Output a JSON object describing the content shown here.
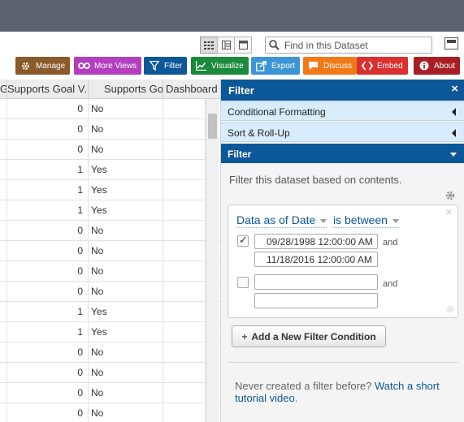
{
  "toolbar": {
    "view_buttons": [
      {
        "icon": "grid-view-icon",
        "active": true
      },
      {
        "icon": "card-view-icon",
        "active": false
      },
      {
        "icon": "single-row-view-icon",
        "active": false
      }
    ],
    "search_placeholder": "Find in this Dataset",
    "buttons": [
      {
        "label": "Manage",
        "icon": "gear-icon",
        "color": "#8a5a2a"
      },
      {
        "label": "More Views",
        "icon": "glasses-icon",
        "color": "#b33fbe"
      },
      {
        "label": "Filter",
        "icon": "funnel-icon",
        "color": "#0c5797"
      },
      {
        "label": "Visualize",
        "icon": "chart-icon",
        "color": "#1c8a3c"
      },
      {
        "label": "Export",
        "icon": "export-icon",
        "color": "#3e95d6"
      },
      {
        "label": "Discuss",
        "icon": "speech-bubble-icon",
        "color": "#f07a18"
      },
      {
        "label": "Embed",
        "icon": "code-brackets-icon",
        "color": "#d8312f"
      },
      {
        "label": "About",
        "icon": "info-icon",
        "color": "#a81e26"
      }
    ]
  },
  "grid": {
    "headers": [
      "G",
      "Supports Goal V.",
      "Supports Goal",
      "Dashboard"
    ],
    "rows": [
      {
        "goal": "0",
        "flag": "No"
      },
      {
        "goal": "0",
        "flag": "No"
      },
      {
        "goal": "0",
        "flag": "No"
      },
      {
        "goal": "1",
        "flag": "Yes"
      },
      {
        "goal": "1",
        "flag": "Yes"
      },
      {
        "goal": "1",
        "flag": "Yes"
      },
      {
        "goal": "0",
        "flag": "No"
      },
      {
        "goal": "0",
        "flag": "No"
      },
      {
        "goal": "0",
        "flag": "No"
      },
      {
        "goal": "0",
        "flag": "No"
      },
      {
        "goal": "1",
        "flag": "Yes"
      },
      {
        "goal": "1",
        "flag": "Yes"
      },
      {
        "goal": "0",
        "flag": "No"
      },
      {
        "goal": "0",
        "flag": "No"
      },
      {
        "goal": "0",
        "flag": "No"
      },
      {
        "goal": "0",
        "flag": "No"
      }
    ]
  },
  "panel": {
    "title": "Filter",
    "close": "×",
    "sections": {
      "conditional_formatting": "Conditional Formatting",
      "sort_rollup": "Sort & Roll-Up",
      "filter": "Filter"
    },
    "description": "Filter this dataset based on contents.",
    "condition": {
      "column": "Data as of Date",
      "operator": "is between",
      "rows": [
        {
          "checked": true,
          "from": "09/28/1998 12:00:00 AM",
          "to": "11/18/2016 12:00:00 AM",
          "and": "and"
        },
        {
          "checked": false,
          "from": "",
          "to": "",
          "and": "and"
        }
      ]
    },
    "add_button": "Add a New Filter Condition",
    "help_prefix": "Never created a filter before?",
    "help_link": "Watch a short tutorial video",
    "help_suffix": "."
  }
}
